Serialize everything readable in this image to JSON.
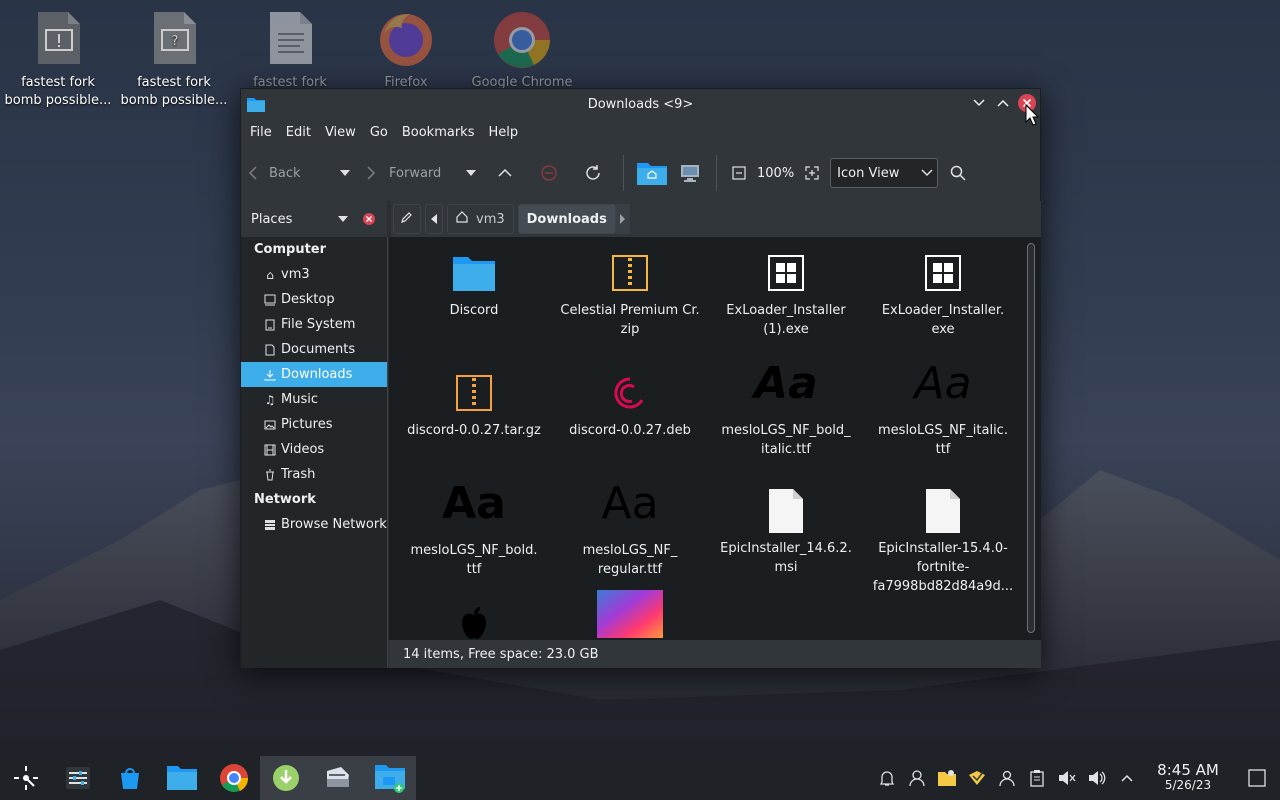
{
  "desktop": {
    "icons": [
      {
        "label": "fastest fork\nbomb possible...",
        "icon": "script-warning-icon"
      },
      {
        "label": "fastest fork\nbomb possible...",
        "icon": "unknown-file-icon"
      },
      {
        "label": "fastest fork",
        "icon": "text-file-icon"
      },
      {
        "label": "Firefox",
        "icon": "firefox-icon"
      },
      {
        "label": "Google Chrome",
        "icon": "chrome-icon"
      }
    ]
  },
  "window": {
    "title": "Downloads <9>",
    "menu": [
      "File",
      "Edit",
      "View",
      "Go",
      "Bookmarks",
      "Help"
    ],
    "toolbar": {
      "back": "Back",
      "forward": "Forward",
      "zoom": "100%",
      "view_mode": "Icon View"
    },
    "places_label": "Places",
    "breadcrumb": [
      "vm3",
      "Downloads"
    ],
    "sidebar": {
      "computer_heading": "Computer",
      "items": [
        "vm3",
        "Desktop",
        "File System",
        "Documents",
        "Downloads",
        "Music",
        "Pictures",
        "Videos",
        "Trash"
      ],
      "selected": "Downloads",
      "network_heading": "Network",
      "network_items": [
        "Browse Network"
      ]
    },
    "files": [
      {
        "name": "Discord",
        "icon": "folder-icon"
      },
      {
        "name": "Celestial Premium Cr.\nzip",
        "icon": "archive-icon"
      },
      {
        "name": "ExLoader_Installer\n(1).exe",
        "icon": "exe-icon"
      },
      {
        "name": "ExLoader_Installer.\nexe",
        "icon": "exe-icon"
      },
      {
        "name": "discord-0.0.27.tar.gz",
        "icon": "archive-icon"
      },
      {
        "name": "discord-0.0.27.deb",
        "icon": "debian-icon"
      },
      {
        "name": "mesloLGS_NF_bold_\nitalic.ttf",
        "icon": "font-icon"
      },
      {
        "name": "mesloLGS_NF_italic.\nttf",
        "icon": "font-icon"
      },
      {
        "name": "mesloLGS_NF_bold.\nttf",
        "icon": "font-icon"
      },
      {
        "name": "mesloLGS_NF_\nregular.ttf",
        "icon": "font-icon"
      },
      {
        "name": "EpicInstaller_14.6.2.\nmsi",
        "icon": "blank-file-icon"
      },
      {
        "name": "EpicInstaller-15.4.0-\nfortnite-\nfa7998bd82d84a9d...",
        "icon": "blank-file-icon"
      },
      {
        "name": "",
        "icon": "apple-icon"
      },
      {
        "name": "",
        "icon": "macos-image-icon"
      }
    ],
    "status": "14 items, Free space: 23.0 GB"
  },
  "taskbar": {
    "time": "8:45 AM",
    "date": "5/26/23"
  },
  "colors": {
    "accent": "#3daee9",
    "close": "#da4453"
  }
}
